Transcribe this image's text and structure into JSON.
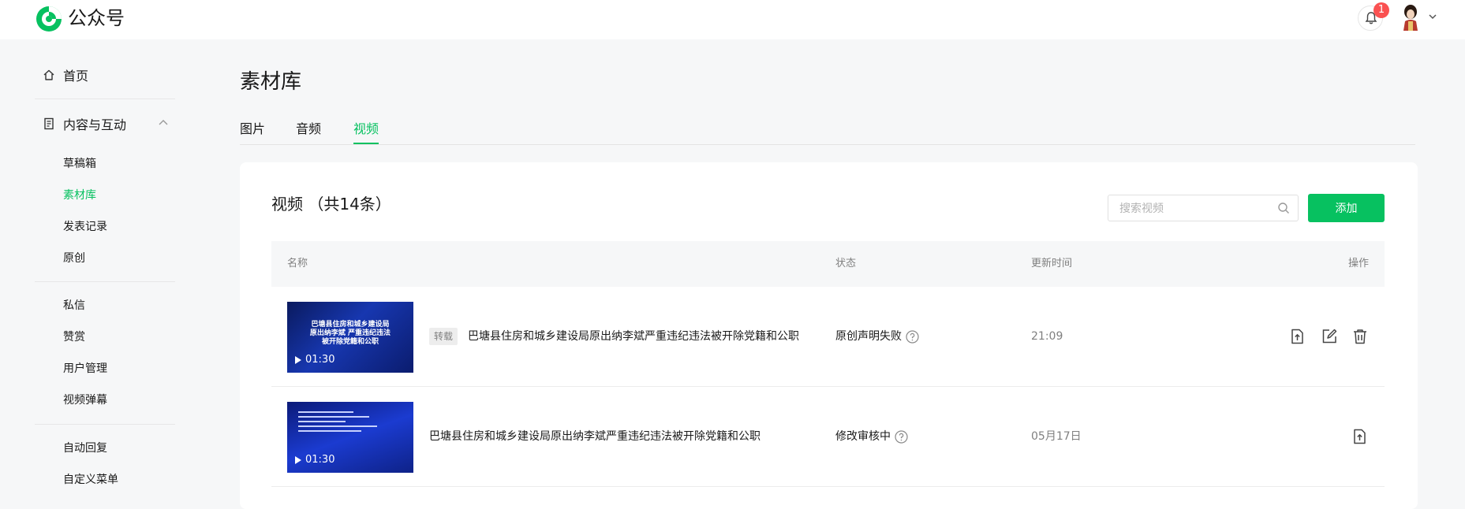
{
  "header": {
    "brand": "公众号",
    "notification_count": "1"
  },
  "sidebar": {
    "home": "首页",
    "group": "内容与互动",
    "items": [
      {
        "label": "草稿箱",
        "active": false
      },
      {
        "label": "素材库",
        "active": true
      },
      {
        "label": "发表记录",
        "active": false
      },
      {
        "label": "原创",
        "active": false
      },
      {
        "label": "私信",
        "active": false
      },
      {
        "label": "赞赏",
        "active": false
      },
      {
        "label": "用户管理",
        "active": false
      },
      {
        "label": "视频弹幕",
        "active": false
      },
      {
        "label": "自动回复",
        "active": false
      },
      {
        "label": "自定义菜单",
        "active": false
      }
    ]
  },
  "main": {
    "title": "素材库",
    "tabs": [
      {
        "label": "图片",
        "active": false
      },
      {
        "label": "音频",
        "active": false
      },
      {
        "label": "视频",
        "active": true
      }
    ],
    "list_title": "视频 （共14条）",
    "search": {
      "placeholder": "搜索视频"
    },
    "add_label": "添加",
    "columns": {
      "name": "名称",
      "status": "状态",
      "updated": "更新时间",
      "actions": "操作"
    },
    "rows": [
      {
        "thumb_text": "巴塘县住房和城乡建设局 原出纳李斌 严重违纪违法 被开除党籍和公职",
        "duration": "01:30",
        "tag": "转载",
        "title": "巴塘县住房和城乡建设局原出纳李斌严重违纪违法被开除党籍和公职",
        "status": "原创声明失败",
        "time": "21:09",
        "actions": [
          "publish-icon",
          "edit-icon",
          "trash-icon"
        ]
      },
      {
        "thumb_text": "",
        "duration": "01:30",
        "tag": "",
        "title": "巴塘县住房和城乡建设局原出纳李斌严重违纪违法被开除党籍和公职",
        "status": "修改审核中",
        "time": "05月17日",
        "actions": [
          "publish-icon"
        ]
      }
    ]
  },
  "colors": {
    "accent": "#07c160",
    "badge": "#fa5151",
    "background": "#f6f7f8"
  }
}
